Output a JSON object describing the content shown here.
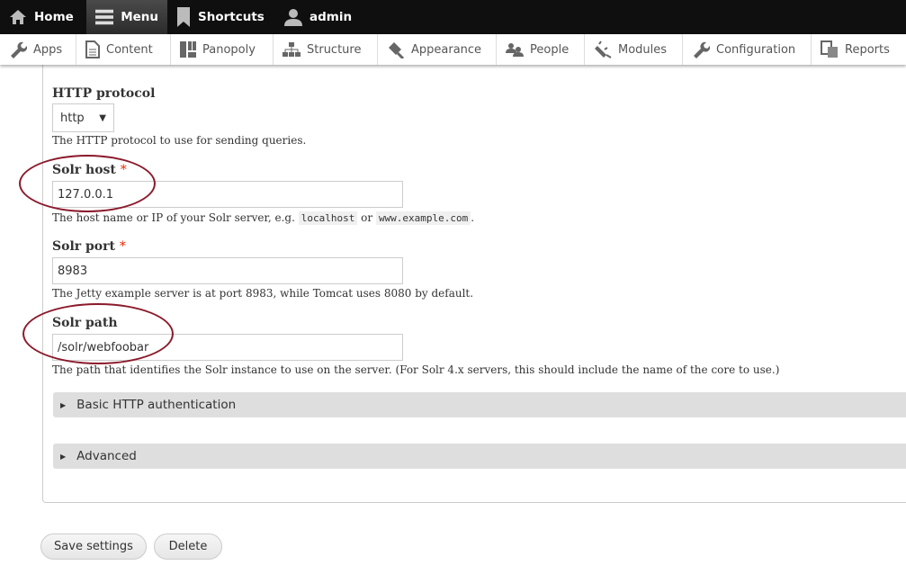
{
  "toolbar": {
    "items": [
      {
        "label": "Home",
        "icon": "home-icon"
      },
      {
        "label": "Menu",
        "icon": "menu-icon",
        "active": true
      },
      {
        "label": "Shortcuts",
        "icon": "bookmark-icon"
      },
      {
        "label": "admin",
        "icon": "user-icon"
      }
    ]
  },
  "tray": {
    "items": [
      {
        "label": "Apps",
        "icon": "wrench-icon"
      },
      {
        "label": "Content",
        "icon": "document-icon"
      },
      {
        "label": "Panopoly",
        "icon": "panels-icon"
      },
      {
        "label": "Structure",
        "icon": "sitemap-icon"
      },
      {
        "label": "Appearance",
        "icon": "paintbrush-icon"
      },
      {
        "label": "People",
        "icon": "people-icon"
      },
      {
        "label": "Modules",
        "icon": "plug-icon"
      },
      {
        "label": "Configuration",
        "icon": "wrench-icon"
      },
      {
        "label": "Reports",
        "icon": "reports-icon"
      }
    ]
  },
  "form": {
    "protocol": {
      "label": "HTTP protocol",
      "value": "http",
      "description": "The HTTP protocol to use for sending queries."
    },
    "host": {
      "label": "Solr host",
      "required": "*",
      "value": "127.0.0.1",
      "desc_pre": "The host name or IP of your Solr server, e.g. ",
      "code1": "localhost",
      "desc_mid": " or ",
      "code2": "www.example.com",
      "desc_post": "."
    },
    "port": {
      "label": "Solr port",
      "required": "*",
      "value": "8983",
      "description": "The Jetty example server is at port 8983, while Tomcat uses 8080 by default."
    },
    "path": {
      "label": "Solr path",
      "value": "/solr/webfoobar",
      "description": "The path that identifies the Solr instance to use on the server. (For Solr 4.x servers, this should include the name of the core to use.)"
    },
    "sections": [
      "Basic HTTP authentication",
      "Advanced"
    ]
  },
  "actions": {
    "save": "Save settings",
    "delete": "Delete"
  },
  "colors": {
    "annotation": "#8b1a2b",
    "required": "#e32700",
    "toolbar": "#0f0f0f"
  }
}
